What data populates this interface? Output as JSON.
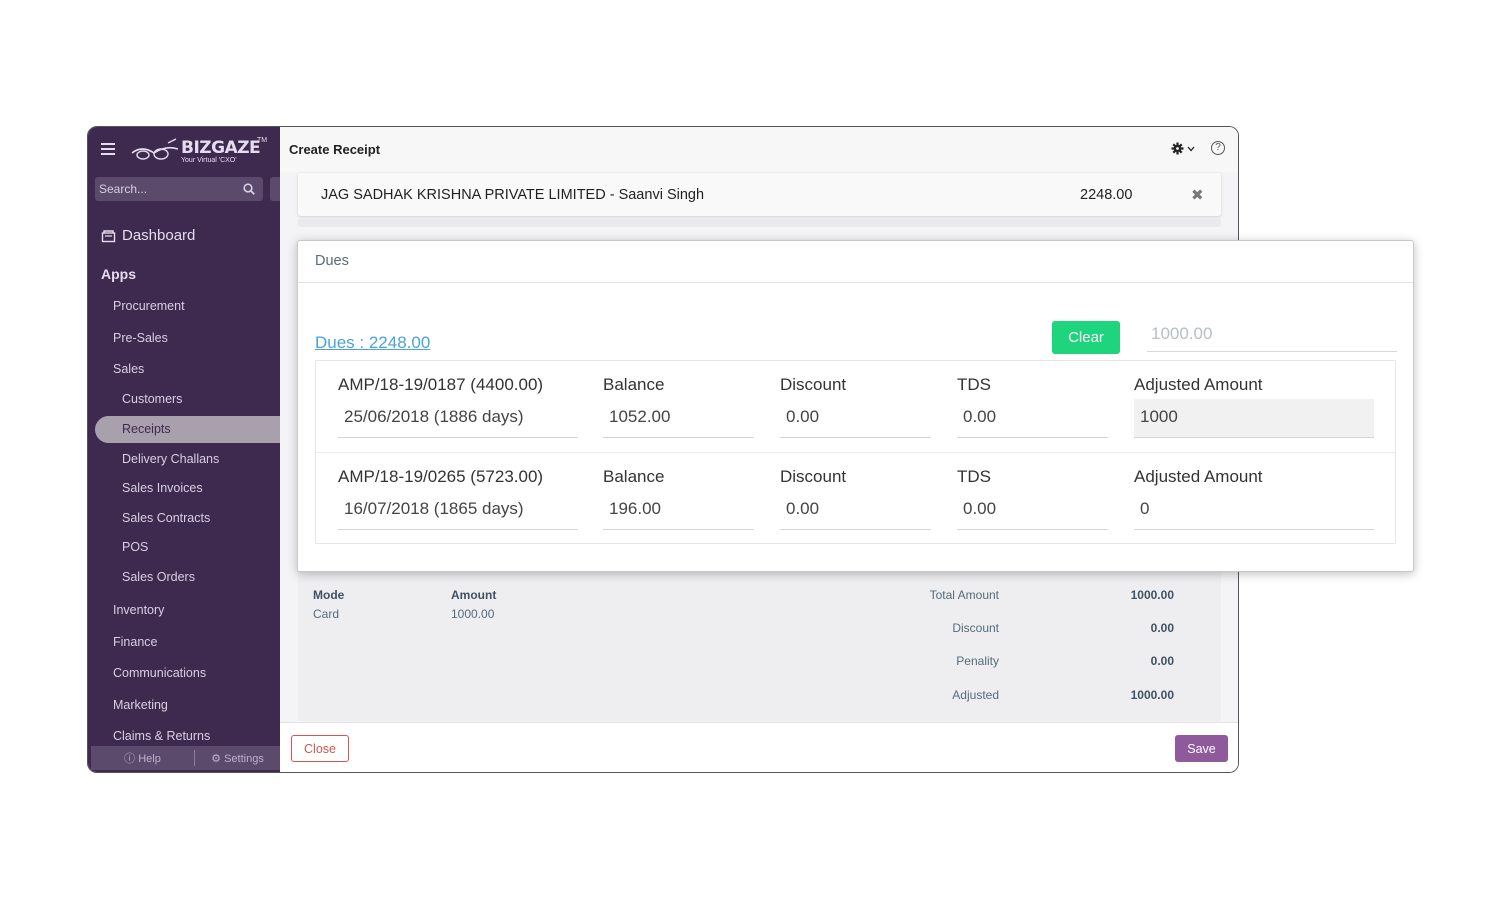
{
  "app": {
    "brand_name": "BIZGAZE",
    "brand_tm": "TM",
    "brand_tagline": "Your Virtual 'CXO'",
    "search_placeholder": "Search..."
  },
  "sidebar": {
    "dashboard_label": "Dashboard",
    "apps_label": "Apps",
    "items": [
      {
        "label": "Procurement"
      },
      {
        "label": "Pre-Sales"
      },
      {
        "label": "Sales"
      }
    ],
    "sales_children": [
      {
        "label": "Customers"
      },
      {
        "label": "Receipts",
        "active": true
      },
      {
        "label": "Delivery Challans"
      },
      {
        "label": "Sales Invoices"
      },
      {
        "label": "Sales Contracts"
      },
      {
        "label": "POS"
      },
      {
        "label": "Sales Orders"
      }
    ],
    "more_items": [
      {
        "label": "Inventory"
      },
      {
        "label": "Finance"
      },
      {
        "label": "Communications"
      },
      {
        "label": "Marketing"
      },
      {
        "label": "Claims & Returns"
      }
    ],
    "footer": {
      "help_label": "Help",
      "settings_label": "Settings"
    }
  },
  "main": {
    "title": "Create Receipt",
    "customer": {
      "name": "JAG SADHAK KRISHNA PRIVATE LIMITED - Saanvi Singh",
      "amount": "2248.00"
    },
    "summary": {
      "mode_header": "Mode",
      "mode_value": "Card",
      "amount_header": "Amount",
      "amount_value": "1000.00",
      "totals": [
        {
          "label": "Total Amount",
          "value": "1000.00"
        },
        {
          "label": "Discount",
          "value": "0.00"
        },
        {
          "label": "Penality",
          "value": "0.00"
        },
        {
          "label": "Adjusted",
          "value": "1000.00"
        }
      ]
    },
    "footer": {
      "close_label": "Close",
      "save_label": "Save"
    }
  },
  "dues_modal": {
    "title": "Dues",
    "dues_link": "Dues : 2248.00",
    "clear_label": "Clear",
    "amount_placeholder": "1000.00",
    "headers": {
      "balance": "Balance",
      "discount": "Discount",
      "tds": "TDS",
      "adjusted": "Adjusted Amount"
    },
    "rows": [
      {
        "invoice": "AMP/18-19/0187 (4400.00)",
        "date": "25/06/2018 (1886 days)",
        "balance": "1052.00",
        "discount": "0.00",
        "tds": "0.00",
        "adjusted": "1000"
      },
      {
        "invoice": "AMP/18-19/0265 (5723.00)",
        "date": "16/07/2018 (1865 days)",
        "balance": "196.00",
        "discount": "0.00",
        "tds": "0.00",
        "adjusted": "0"
      }
    ]
  },
  "colors": {
    "sidebar_bg": "#3e2a4f",
    "clear_button": "#1ed47d",
    "save_button": "#8e5a9c",
    "close_button": "#d9534f",
    "link": "#4aa3dd"
  }
}
